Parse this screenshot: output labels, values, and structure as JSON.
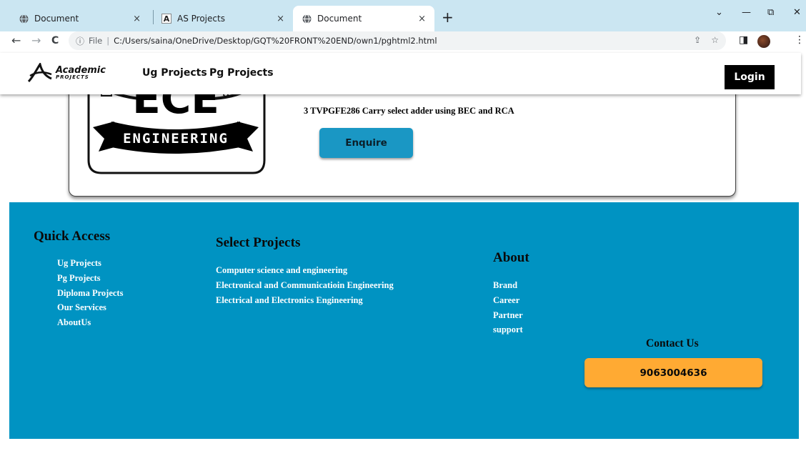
{
  "browser": {
    "tabs": [
      {
        "title": "Document",
        "icon": "globe-icon",
        "close": "×"
      },
      {
        "title": "AS Projects",
        "icon": "site-logo-icon",
        "close": "×"
      },
      {
        "title": "Document",
        "icon": "globe-icon",
        "close": "×"
      }
    ],
    "new_tab": "+",
    "window_controls": {
      "dropdown": "⌄",
      "minimize": "—",
      "restore": "⧉",
      "close": "✕"
    },
    "nav": {
      "back": "←",
      "forward": "→",
      "reload": "C"
    },
    "address": {
      "info_icon": "ⓘ",
      "scheme_label": "File",
      "url": "C:/Users/saina/OneDrive/Desktop/GQT%20FRONT%20END/own1/pghtml2.html"
    }
  },
  "site": {
    "logo": {
      "line1": "Academic",
      "line2": "PROJECTS"
    },
    "nav": {
      "ug": "Ug Projects",
      "pg": "Pg Projects"
    },
    "login_label": "Login"
  },
  "project": {
    "badge_text": "ENGINEERING",
    "badge_top": "ECE",
    "title": "3 TVPGFE286 Carry select adder using BEC and RCA",
    "enquire_label": "Enquire"
  },
  "footer": {
    "quick_access": {
      "heading": "Quick Access",
      "items": [
        "Ug Projects",
        "Pg Projects",
        "Diploma Projects",
        "Our Services",
        "AboutUs"
      ]
    },
    "select_projects": {
      "heading": "Select Projects",
      "items": [
        "Computer science and engineering",
        "Electronical and Communicatioin Engineering",
        "Electrical and Electronics Engineering"
      ]
    },
    "about": {
      "heading": "About",
      "items": [
        "Brand",
        "Career",
        "Partner",
        "support"
      ]
    },
    "contact": {
      "heading": "Contact Us",
      "phone": "9063004636"
    }
  },
  "colors": {
    "footer_bg": "#0093c2",
    "enquire_bg": "#1a97c4",
    "phone_bg": "#ffaa33",
    "login_bg": "#000000"
  }
}
